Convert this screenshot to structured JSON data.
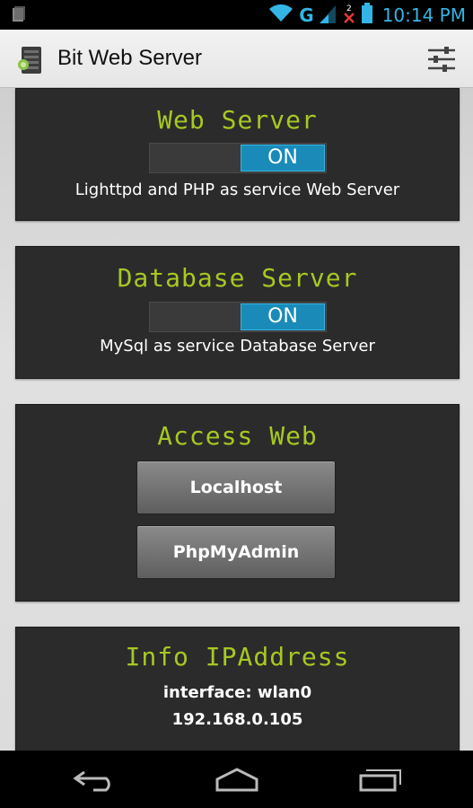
{
  "status_bar": {
    "network_type": "G",
    "time": "10:14 PM"
  },
  "action_bar": {
    "title": "Bit Web Server"
  },
  "panels": {
    "web_server": {
      "title": "Web Server",
      "toggle_label": "ON",
      "description": "Lighttpd and PHP as service Web Server"
    },
    "database_server": {
      "title": "Database Server",
      "toggle_label": "ON",
      "description": "MySql as service Database Server"
    },
    "access_web": {
      "title": "Access Web",
      "buttons": [
        "Localhost",
        "PhpMyAdmin"
      ]
    },
    "info": {
      "title": "Info IPAddress",
      "interface": "interface: wlan0",
      "ip": "192.168.0.105"
    }
  },
  "colors": {
    "accent_green": "#a6c822",
    "toggle_blue": "#1a8bb8",
    "system_blue": "#33b5e5"
  }
}
